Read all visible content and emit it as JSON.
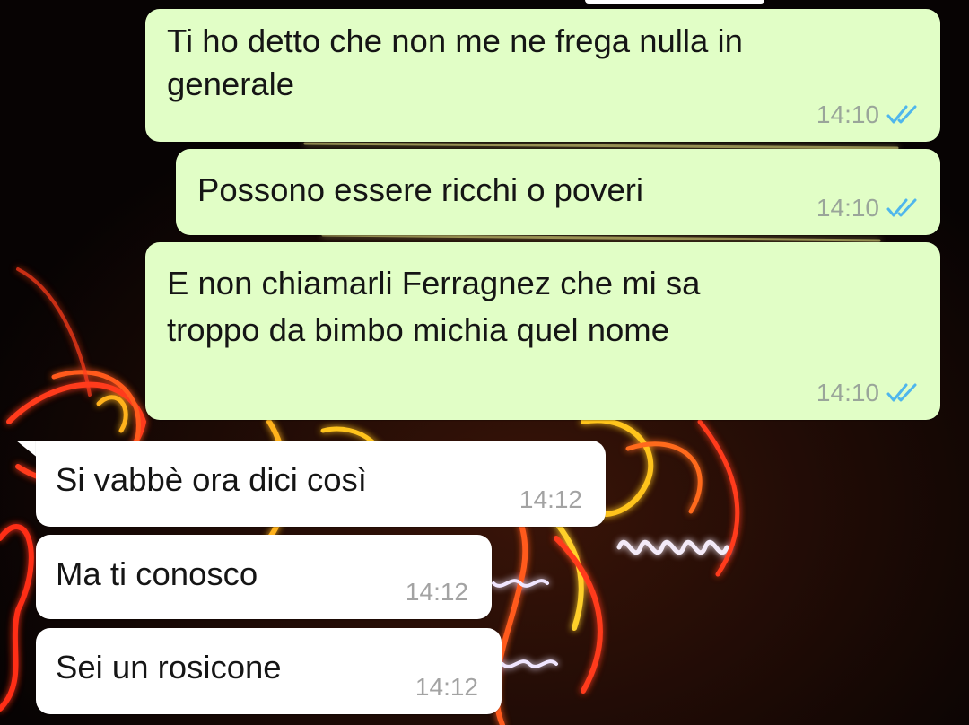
{
  "conversation": {
    "messages": [
      {
        "direction": "outgoing",
        "text_lines": [
          "Ti ho detto che non me ne frega nulla in",
          "generale"
        ],
        "time": "14:10",
        "status_icon": "double-check-read-icon"
      },
      {
        "direction": "outgoing",
        "text_lines": [
          "Possono essere ricchi o poveri"
        ],
        "time": "14:10",
        "status_icon": "double-check-read-icon"
      },
      {
        "direction": "outgoing",
        "text_lines": [
          "E non chiamarli Ferragnez che mi sa",
          "troppo da bimbo michia quel nome"
        ],
        "time": "14:10",
        "status_icon": "double-check-read-icon"
      },
      {
        "direction": "incoming",
        "text_lines": [
          "Si vabbè ora dici così"
        ],
        "time": "14:12"
      },
      {
        "direction": "incoming",
        "text_lines": [
          "Ma ti conosco"
        ],
        "time": "14:12"
      },
      {
        "direction": "incoming",
        "text_lines": [
          "Sei un rosicone"
        ],
        "time": "14:12"
      }
    ]
  },
  "colors": {
    "outgoing_bubble": "#e1fec6",
    "incoming_bubble": "#ffffff",
    "read_ticks": "#4fb6ec",
    "timestamp": "#9aa59a"
  }
}
